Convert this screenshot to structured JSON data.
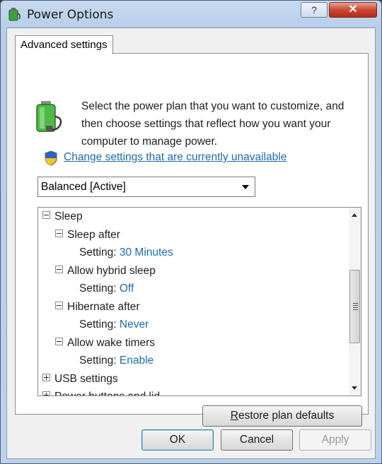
{
  "window": {
    "title": "Power Options",
    "help_label": "?",
    "close_label": "✕"
  },
  "tab": {
    "label": "Advanced settings"
  },
  "description": "Select the power plan that you want to customize, and then choose settings that reflect how you want your computer to manage power.",
  "change_link": "Change settings that are currently unavailable",
  "plan_select": {
    "value": "Balanced [Active]"
  },
  "tree": {
    "sleep": "Sleep",
    "sleep_after": {
      "label": "Sleep after",
      "setting_label": "Setting:",
      "value": "30 Minutes"
    },
    "hybrid_sleep": {
      "label": "Allow hybrid sleep",
      "setting_label": "Setting:",
      "value": "Off"
    },
    "hibernate_after": {
      "label": "Hibernate after",
      "setting_label": "Setting:",
      "value": "Never"
    },
    "wake_timers": {
      "label": "Allow wake timers",
      "setting_label": "Setting:",
      "value": "Enable"
    },
    "usb": "USB settings",
    "power_buttons": "Power buttons and lid"
  },
  "buttons": {
    "restore_first": "R",
    "restore_rest": "estore plan defaults",
    "ok": "OK",
    "cancel": "Cancel",
    "apply": "Apply"
  },
  "colors": {
    "link": "#1d6bb0",
    "close": "#c9472f"
  }
}
